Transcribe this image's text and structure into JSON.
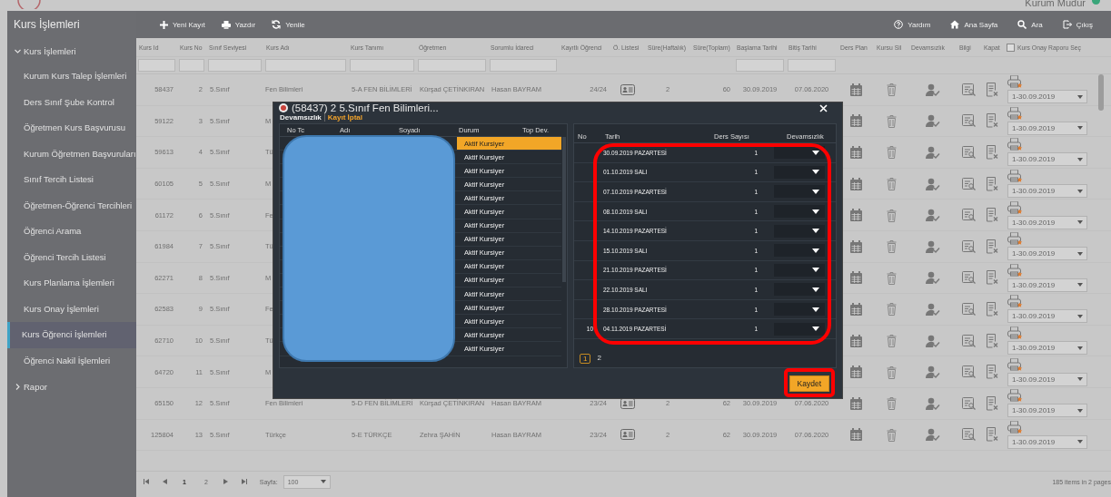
{
  "top_bar": {
    "user": "Kurum Müdür"
  },
  "sidebar": {
    "title": "Kurs İşlemleri",
    "groups": [
      {
        "label": "Kurs İşlemleri",
        "expanded": true,
        "children": [
          {
            "label": "Kurum Kurs Talep İşlemleri",
            "selected": false
          },
          {
            "label": "Ders Sınıf Şube Kontrol",
            "selected": false
          },
          {
            "label": "Öğretmen Kurs Başvurusu",
            "selected": false
          },
          {
            "label": "Kurum Öğretmen Başvuruları",
            "selected": false
          },
          {
            "label": "Sınıf Tercih Listesi",
            "selected": false
          },
          {
            "label": "Öğretmen-Öğrenci Tercihleri",
            "selected": false
          },
          {
            "label": "Öğrenci Arama",
            "selected": false
          },
          {
            "label": "Öğrenci Tercih Listesi",
            "selected": false
          },
          {
            "label": "Kurs Planlama İşlemleri",
            "selected": false
          },
          {
            "label": "Kurs Onay İşlemleri",
            "selected": false
          },
          {
            "label": "Kurs Öğrenci İşlemleri",
            "selected": true
          },
          {
            "label": "Öğrenci Nakil İşlemleri",
            "selected": false
          }
        ]
      },
      {
        "label": "Rapor",
        "expanded": false
      }
    ]
  },
  "toolbar": {
    "left": [
      "Yeni Kayıt",
      "Yazdır",
      "Yenile"
    ],
    "right": [
      "Yardım",
      "Ana Sayfa",
      "Ara",
      "Çıkış"
    ]
  },
  "table": {
    "columns": [
      {
        "label": "Kurs Id",
        "filter": true
      },
      {
        "label": "Kurs No",
        "filter": true
      },
      {
        "label": "Sınıf Seviyesi",
        "filter": true
      },
      {
        "label": "Kurs Adı",
        "filter": true
      },
      {
        "label": "Kurs Tanımı",
        "filter": true
      },
      {
        "label": "Öğretmen",
        "filter": true
      },
      {
        "label": "Sorumlu İdareci",
        "filter": true
      },
      {
        "label": "Kayıtlı Öğrenci",
        "filter": false
      },
      {
        "label": "Ö. Listesi",
        "filter": false
      },
      {
        "label": "Süre(Haftalık)",
        "filter": false
      },
      {
        "label": "Süre(Toplam)",
        "filter": false
      },
      {
        "label": "Başlama Tarihi",
        "filter": true
      },
      {
        "label": "Bitiş Tarihi",
        "filter": true
      },
      {
        "label": "Ders Plan",
        "filter": false
      },
      {
        "label": "Kursu Sil",
        "filter": false
      },
      {
        "label": "Devamsızlık",
        "filter": false
      },
      {
        "label": "Bilgi",
        "filter": false
      },
      {
        "label": "Kapat",
        "filter": false
      }
    ],
    "report_column": {
      "label": "Kurs Onay Raporu Seç",
      "checked": false
    },
    "rows": [
      {
        "id": "58437",
        "no": "2",
        "level": "5.Sınıf",
        "name": "Fen Bilimleri",
        "desc": "5-A FEN BİLİMLERİ",
        "teacher": "Kürşad ÇETİNKIRAN",
        "admin": "Hasan BAYRAM",
        "enrolled": "24/24",
        "weekly": "2",
        "total": "60",
        "start": "30.09.2019",
        "end": "07.06.2020",
        "report": "1-30.09.2019"
      },
      {
        "id": "59122",
        "no": "3",
        "level": "5.Sınıf",
        "name": "M",
        "report": "1-30.09.2019"
      },
      {
        "id": "59613",
        "no": "4",
        "level": "5.Sınıf",
        "name": "Tü",
        "report": "1-30.09.2019"
      },
      {
        "id": "60105",
        "no": "5",
        "level": "5.Sınıf",
        "name": "M",
        "report": "1-30.09.2019"
      },
      {
        "id": "61172",
        "no": "6",
        "level": "5.Sınıf",
        "name": "Fe",
        "report": "1-30.09.2019"
      },
      {
        "id": "61984",
        "no": "7",
        "level": "5.Sınıf",
        "name": "Tü",
        "report": "1-30.09.2019"
      },
      {
        "id": "62271",
        "no": "8",
        "level": "5.Sınıf",
        "name": "M",
        "report": "1-30.09.2019"
      },
      {
        "id": "62583",
        "no": "9",
        "level": "5.Sınıf",
        "name": "Fe",
        "report": "1-30.09.2019"
      },
      {
        "id": "62710",
        "no": "10",
        "level": "5.Sınıf",
        "name": "Tü",
        "report": "1-30.09.2019"
      },
      {
        "id": "64720",
        "no": "11",
        "level": "5.Sınıf",
        "name": "M",
        "report": "1-30.09.2019"
      },
      {
        "id": "65150",
        "no": "12",
        "level": "5.Sınıf",
        "name": "Fen Bilimleri",
        "desc": "5-D FEN BİLİMLERİ",
        "teacher": "Kürşad ÇETİNKIRAN",
        "admin": "Hasan BAYRAM",
        "enrolled": "23/24",
        "weekly": "2",
        "total": "62",
        "start": "30.09.2019",
        "end": "07.06.2020",
        "report": "1-30.09.2019"
      },
      {
        "id": "125804",
        "no": "13",
        "level": "5.Sınıf",
        "name": "Türkçe",
        "desc": "5-E TÜRKÇE",
        "teacher": "Zehra ŞAHİN",
        "admin": "Hasan BAYRAM",
        "enrolled": "23/24",
        "weekly": "2",
        "total": "62",
        "start": "30.09.2019",
        "end": "07.06.2020",
        "report": "1-30.09.2019"
      }
    ]
  },
  "pager": {
    "pages": [
      {
        "label": "1",
        "selected": true
      },
      {
        "label": "2",
        "selected": false
      }
    ],
    "size_label": "Sayfa:",
    "size": "100",
    "summary": "185 items in 2 pages"
  },
  "dialog": {
    "title": "(58437) 2 5.Sınıf Fen Bilimleri...",
    "tabs": [
      {
        "label": "Devamsızlık",
        "selected": true
      },
      {
        "label": "Kayıt İptal",
        "selected": false
      }
    ],
    "students": {
      "columns": [
        "No Tc",
        "Adı",
        "Soyadı",
        "Durum",
        "Top Dev."
      ],
      "redacted": true,
      "rows": [
        {
          "status": "Aktif Kursiyer",
          "selected": true
        },
        {
          "status": "Aktif Kursiyer",
          "selected": false
        },
        {
          "status": "Aktif Kursiyer",
          "selected": false
        },
        {
          "status": "Aktif Kursiyer",
          "selected": false
        },
        {
          "status": "Aktif Kursiyer",
          "selected": false
        },
        {
          "status": "Aktif Kursiyer",
          "selected": false
        },
        {
          "status": "Aktif Kursiyer",
          "selected": false
        },
        {
          "status": "Aktif Kursiyer",
          "selected": false
        },
        {
          "status": "Aktif Kursiyer",
          "selected": false
        },
        {
          "status": "Aktif Kursiyer",
          "selected": false
        },
        {
          "status": "Aktif Kursiyer",
          "selected": false
        },
        {
          "status": "Aktif Kursiyer",
          "selected": false
        },
        {
          "status": "Aktif Kursiyer",
          "selected": false
        },
        {
          "status": "Aktif Kursiyer",
          "selected": false
        },
        {
          "status": "Aktif Kursiyer",
          "selected": false
        },
        {
          "status": "Aktif Kursiyer",
          "selected": false
        }
      ]
    },
    "attendance": {
      "columns": [
        "No",
        "Tarih",
        "Ders Sayısı",
        "Devamsızlık"
      ],
      "highlighted": true,
      "rows": [
        {
          "date": "30.09.2019 PAZARTESİ",
          "count": "1"
        },
        {
          "date": "01.10.2019 SALI",
          "count": "1"
        },
        {
          "date": "07.10.2019 PAZARTESİ",
          "count": "1"
        },
        {
          "date": "08.10.2019 SALI",
          "count": "1"
        },
        {
          "date": "14.10.2019 PAZARTESİ",
          "count": "1"
        },
        {
          "date": "15.10.2019 SALI",
          "count": "1"
        },
        {
          "date": "21.10.2019 PAZARTESİ",
          "count": "1"
        },
        {
          "date": "22.10.2019 SALI",
          "count": "1"
        },
        {
          "date": "28.10.2019 PAZARTESİ",
          "count": "1"
        },
        {
          "no": "10",
          "date": "04.11.2019 PAZARTESİ",
          "count": "1"
        }
      ],
      "pages": [
        {
          "label": "1",
          "selected": true
        },
        {
          "label": "2",
          "selected": false
        }
      ]
    },
    "save_button": {
      "label": "Kaydet",
      "highlighted": true
    }
  }
}
